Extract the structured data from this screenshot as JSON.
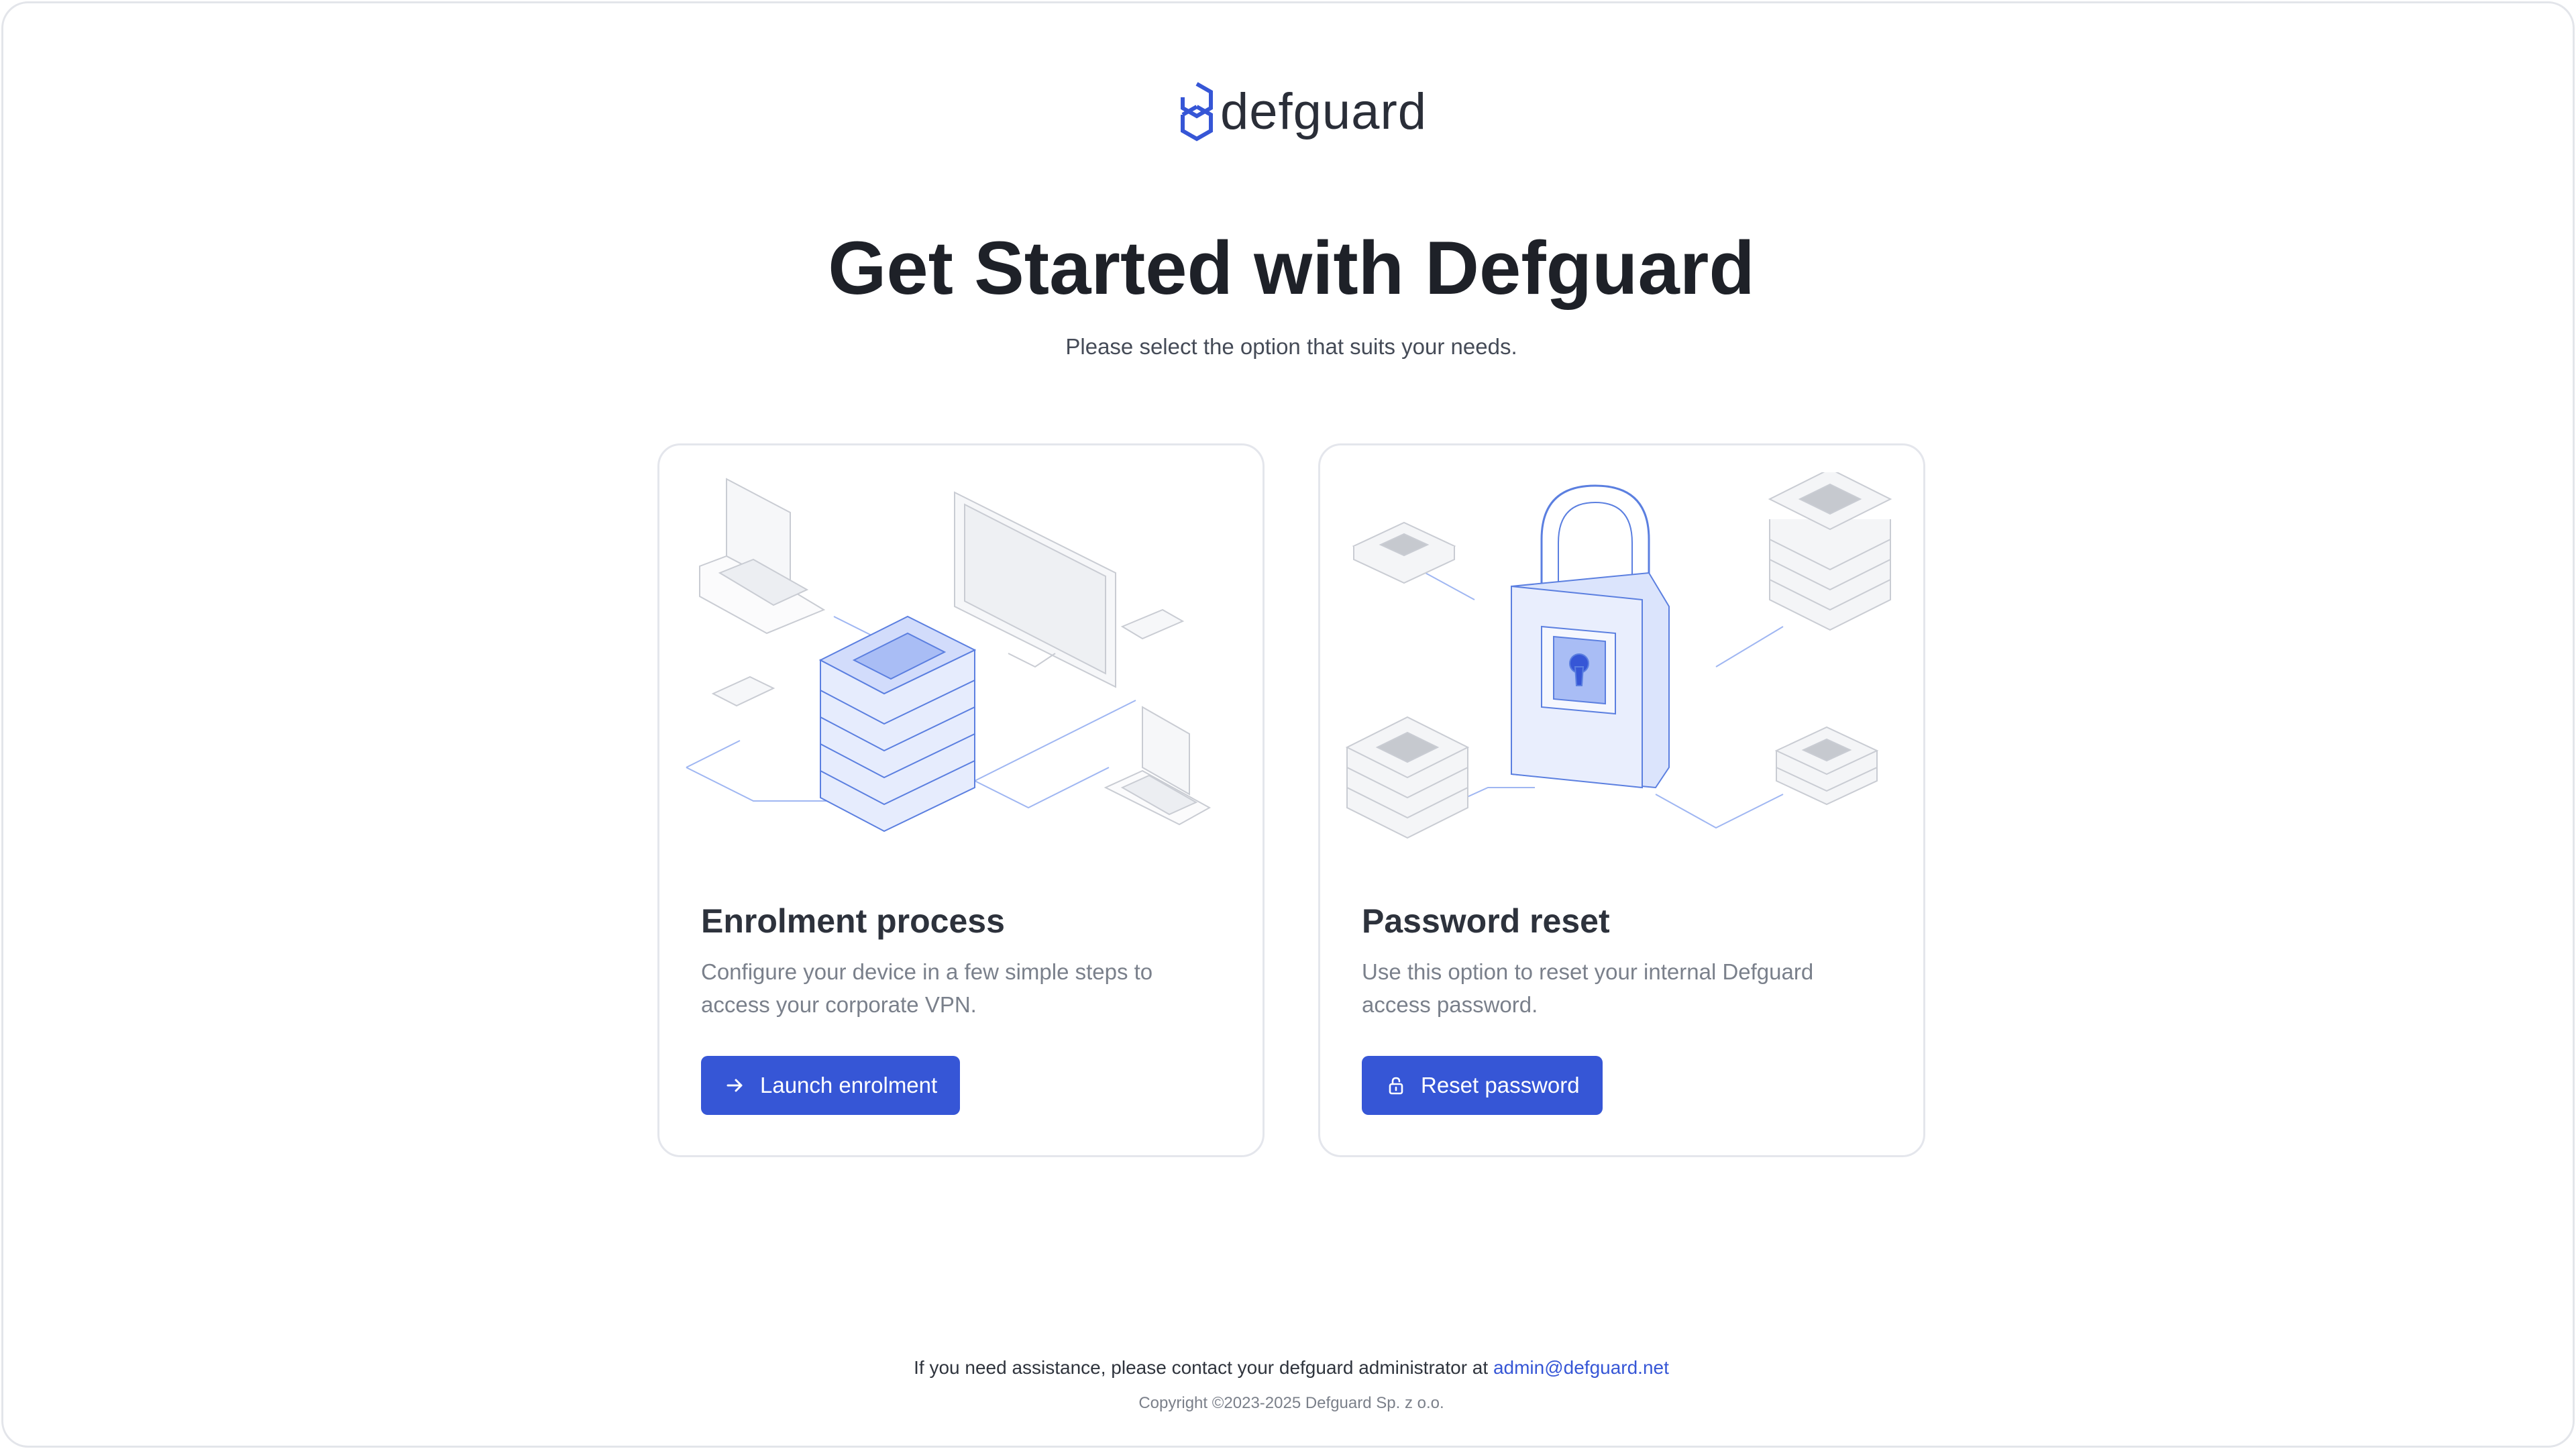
{
  "brand": {
    "name": "defguard",
    "icon": "defguard-logo-icon",
    "accent": "#3656d6"
  },
  "hero": {
    "title": "Get Started with Defguard",
    "subtitle": "Please select the option that suits your needs."
  },
  "cards": [
    {
      "title": "Enrolment process",
      "description": "Configure your device in a few simple steps to access your corporate VPN.",
      "button_label": "Launch enrolment",
      "button_icon": "arrow-right-icon",
      "illustration": "server-devices-illustration"
    },
    {
      "title": "Password reset",
      "description": "Use this option to reset your internal Defguard access password.",
      "button_label": "Reset password",
      "button_icon": "padlock-icon",
      "illustration": "padlock-servers-illustration"
    }
  ],
  "footer": {
    "assist_text": "If you need assistance, please contact your defguard administrator at",
    "email": "admin@defguard.net",
    "copyright": "Copyright ©2023-2025 Defguard Sp. z o.o."
  }
}
